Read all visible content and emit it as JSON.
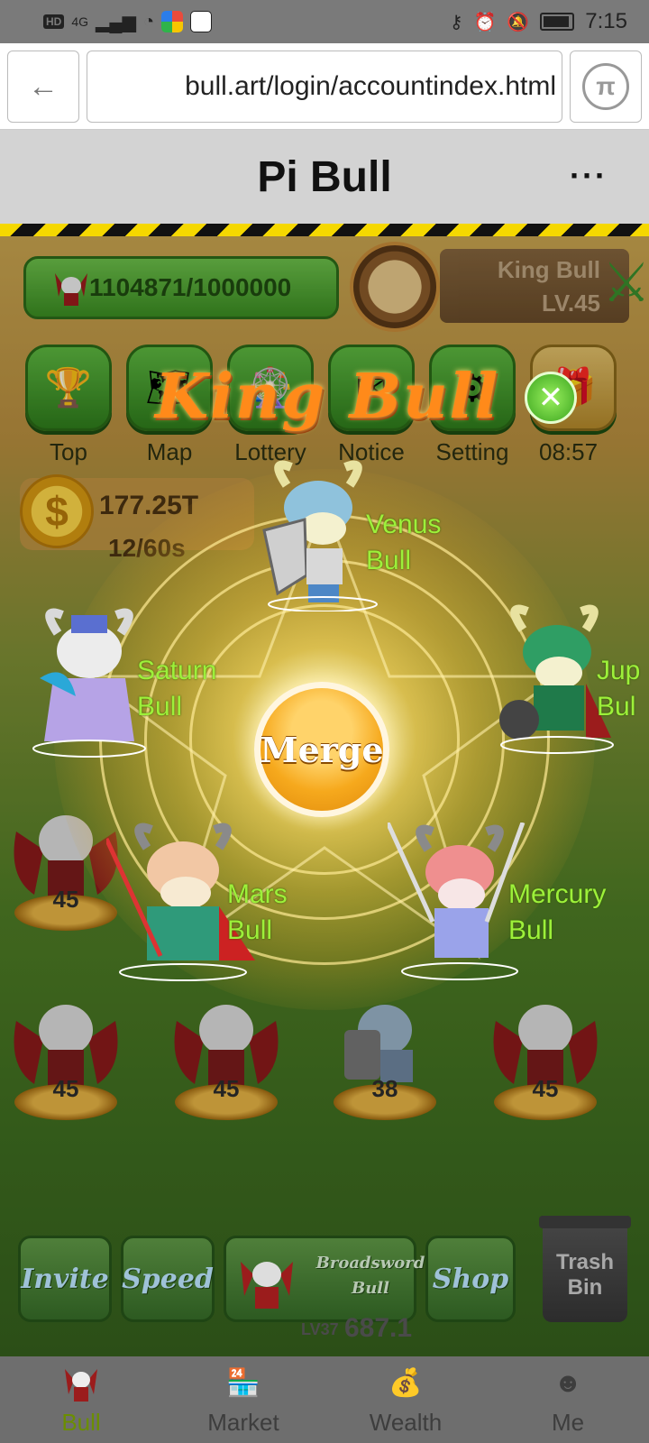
{
  "status_bar": {
    "time": "7:15",
    "network": "4G",
    "hd": "HD"
  },
  "browser": {
    "url": "bull.art/login/accountindex.html",
    "pi_symbol": "π"
  },
  "header": {
    "title": "Pi Bull",
    "more": "···"
  },
  "game": {
    "energy": "1104871/1000000",
    "profile": {
      "name": "King Bull",
      "level": "LV.45"
    },
    "menu": [
      {
        "label": "Top",
        "icon": "trophy-icon"
      },
      {
        "label": "Map",
        "icon": "map-icon"
      },
      {
        "label": "Lottery",
        "icon": "wheel-icon"
      },
      {
        "label": "Notice",
        "icon": "envelope-icon"
      },
      {
        "label": "Setting",
        "icon": "gear-icon"
      }
    ],
    "timer": "08:57",
    "coins": {
      "value": "177.25T",
      "rate": "12/60s"
    },
    "popup": {
      "title": "King Bull",
      "merge_label": "Merge",
      "planets": [
        {
          "line1": "Venus",
          "line2": "Bull"
        },
        {
          "line1": "Saturn",
          "line2": "Bull"
        },
        {
          "line1": "Jup",
          "line2": "Bul"
        },
        {
          "line1": "Mars",
          "line2": "Bull"
        },
        {
          "line1": "Mercury",
          "line2": "Bull"
        }
      ]
    },
    "field_levels": [
      "45",
      "45",
      "45",
      "38",
      "45"
    ],
    "bottom_buttons": {
      "invite": "Invite",
      "speed": "Speed",
      "broadsword_line1": "Broadsword",
      "broadsword_line2": "Bull",
      "broadsword_level": "LV37",
      "broadsword_value": "687.1",
      "shop": "Shop",
      "trash_line1": "Trash",
      "trash_line2": "Bin"
    }
  },
  "nav": [
    {
      "label": "Bull",
      "icon": "bull-icon",
      "active": true
    },
    {
      "label": "Market",
      "icon": "store-icon",
      "active": false
    },
    {
      "label": "Wealth",
      "icon": "money-bag-icon",
      "active": false
    },
    {
      "label": "Me",
      "icon": "user-icon",
      "active": false
    }
  ]
}
